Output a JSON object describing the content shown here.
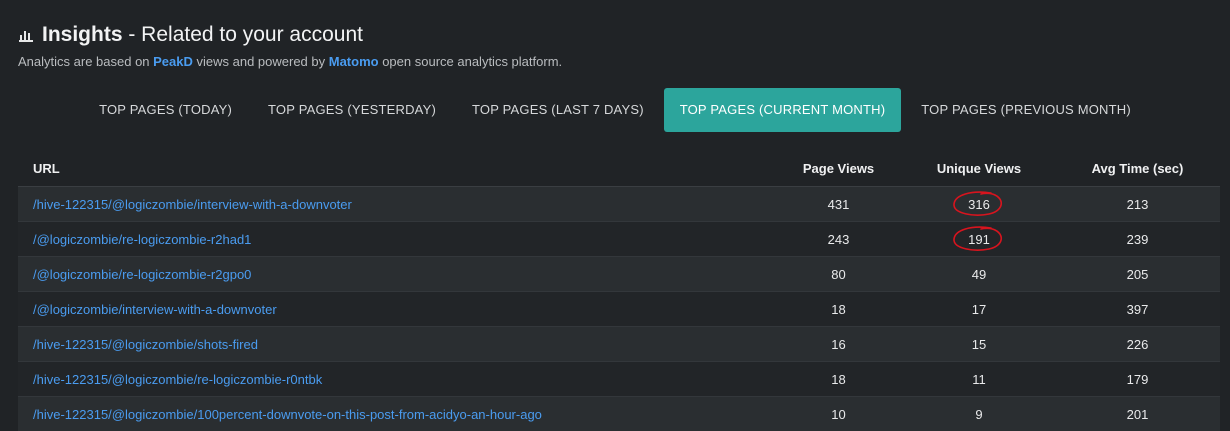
{
  "header": {
    "title_strong": "Insights",
    "title_rest": " - Related to your account",
    "icon": "bar-chart-icon",
    "subtitle": {
      "part1": "Analytics are based on ",
      "link1": "PeakD",
      "part2": " views and powered by ",
      "link2": "Matomo",
      "part3": " open source analytics platform."
    }
  },
  "tabs": [
    {
      "label": "TOP PAGES (TODAY)",
      "active": false
    },
    {
      "label": "TOP PAGES (YESTERDAY)",
      "active": false
    },
    {
      "label": "TOP PAGES (LAST 7 DAYS)",
      "active": false
    },
    {
      "label": "TOP PAGES (CURRENT MONTH)",
      "active": true
    },
    {
      "label": "TOP PAGES (PREVIOUS MONTH)",
      "active": false
    }
  ],
  "table": {
    "headers": {
      "url": "URL",
      "page_views": "Page Views",
      "unique_views": "Unique Views",
      "avg_time": "Avg Time (sec)"
    },
    "rows": [
      {
        "url": "/hive-122315/@logiczombie/interview-with-a-downvoter",
        "page_views": "431",
        "unique_views": "316",
        "avg_time": "213",
        "circled": true
      },
      {
        "url": "/@logiczombie/re-logiczombie-r2had1",
        "page_views": "243",
        "unique_views": "191",
        "avg_time": "239",
        "circled": true
      },
      {
        "url": "/@logiczombie/re-logiczombie-r2gpo0",
        "page_views": "80",
        "unique_views": "49",
        "avg_time": "205",
        "circled": false
      },
      {
        "url": "/@logiczombie/interview-with-a-downvoter",
        "page_views": "18",
        "unique_views": "17",
        "avg_time": "397",
        "circled": false
      },
      {
        "url": "/hive-122315/@logiczombie/shots-fired",
        "page_views": "16",
        "unique_views": "15",
        "avg_time": "226",
        "circled": false
      },
      {
        "url": "/hive-122315/@logiczombie/re-logiczombie-r0ntbk",
        "page_views": "18",
        "unique_views": "11",
        "avg_time": "179",
        "circled": false
      },
      {
        "url": "/hive-122315/@logiczombie/100percent-downvote-on-this-post-from-acidyo-an-hour-ago",
        "page_views": "10",
        "unique_views": "9",
        "avg_time": "201",
        "circled": false
      }
    ]
  },
  "colors": {
    "accent": "#2ca59c",
    "link": "#4a9cf0",
    "annotation": "#d8141e"
  }
}
